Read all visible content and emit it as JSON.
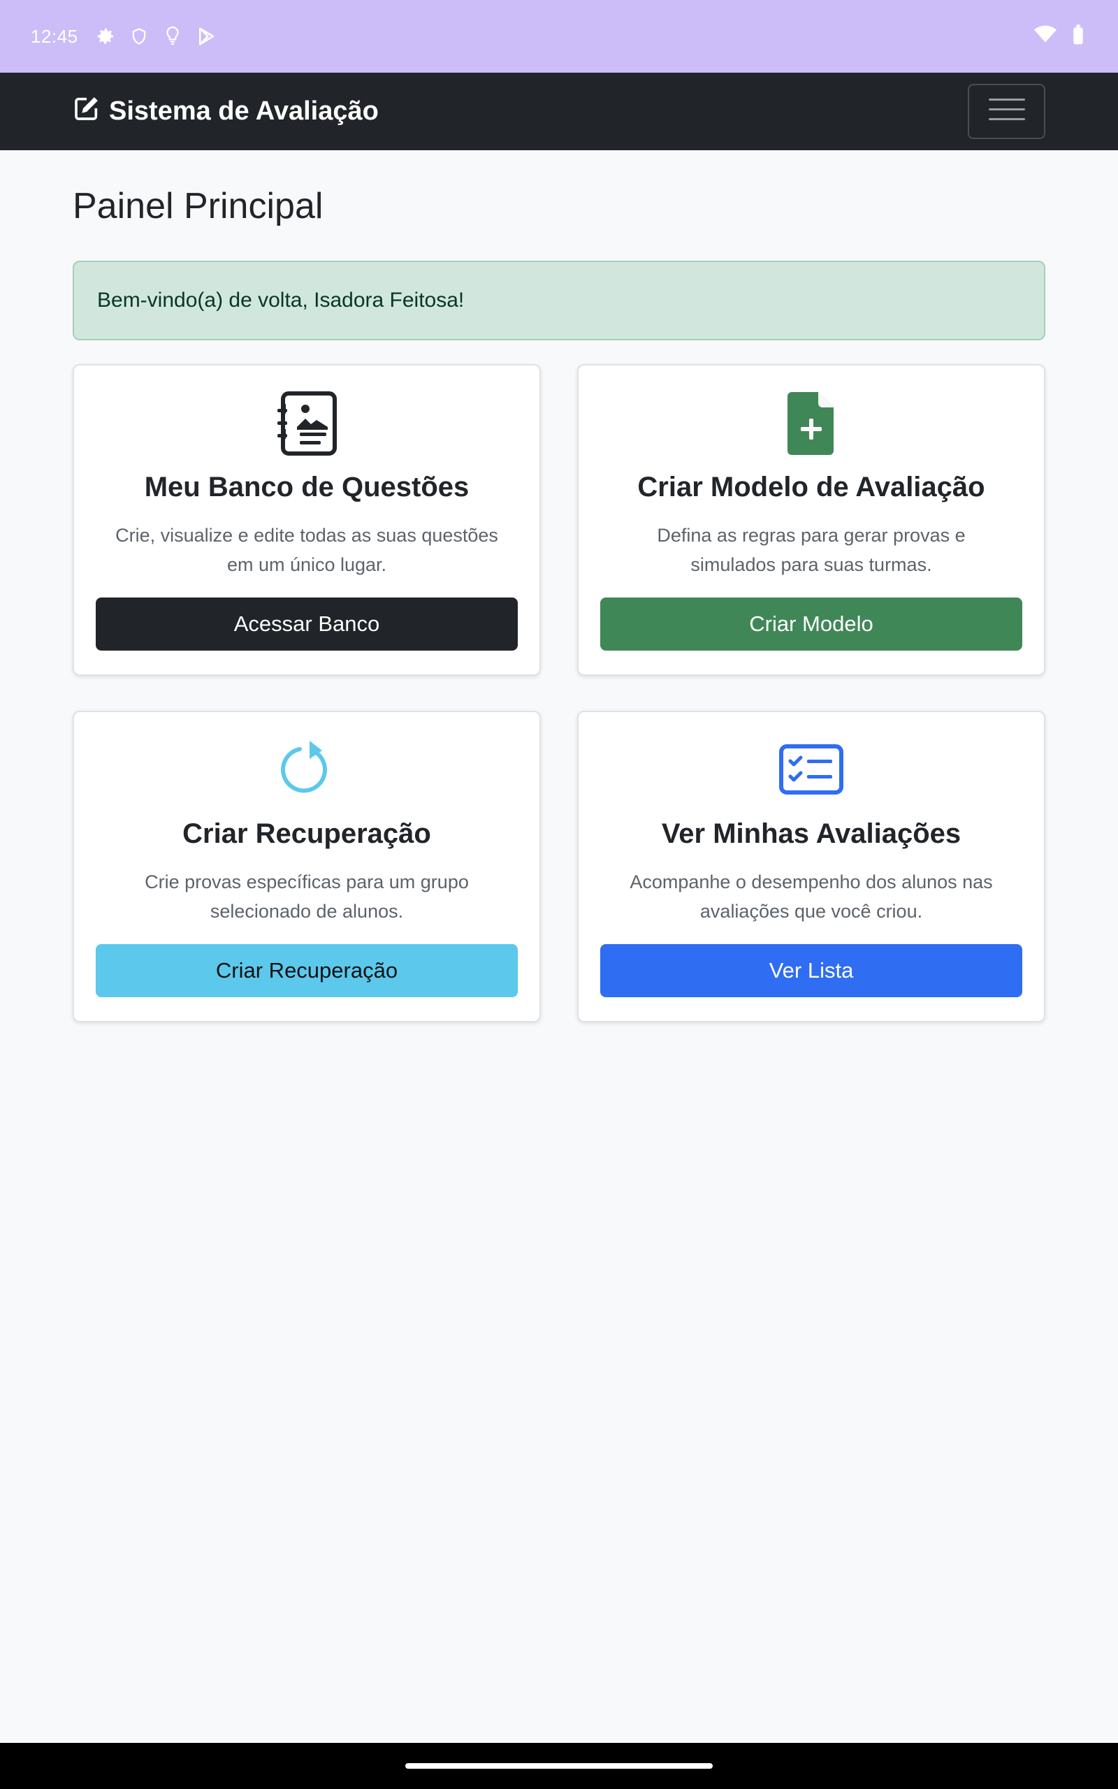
{
  "statusbar": {
    "time": "12:45",
    "left_icons": [
      "gear-icon",
      "shield-icon",
      "lightbulb-icon",
      "play-store-icon"
    ],
    "right_icons": [
      "wifi-icon",
      "battery-icon"
    ]
  },
  "navbar": {
    "brand_icon": "pencil-square-icon",
    "brand": "Sistema de Avaliação",
    "toggler_icon": "hamburger-menu-icon"
  },
  "page": {
    "title": "Painel Principal",
    "welcome": "Bem-vindo(a) de volta, Isadora Feitosa!"
  },
  "cards": [
    {
      "icon": "journal-list-icon",
      "icon_color": "#212529",
      "title": "Meu Banco de Questões",
      "text": "Crie, visualize e edite todas as suas questões em um único lugar.",
      "button": "Acessar Banco",
      "button_color": "#212529"
    },
    {
      "icon": "file-plus-icon",
      "icon_color": "#408758",
      "title": "Criar Modelo de Avaliação",
      "text": "Defina as regras para gerar provas e simulados para suas turmas.",
      "button": "Criar Modelo",
      "button_color": "#408758"
    },
    {
      "icon": "arrow-clockwise-icon",
      "icon_color": "#5cc8ec",
      "title": "Criar Recuperação",
      "text": "Crie provas específicas para um grupo selecionado de alunos.",
      "button": "Criar Recuperação",
      "button_color": "#5cc8ec"
    },
    {
      "icon": "checklist-icon",
      "icon_color": "#2f6df2",
      "title": "Ver Minhas Avaliações",
      "text": "Acompanhe o desempenho dos alunos nas avaliações que você criou.",
      "button": "Ver Lista",
      "button_color": "#2f6df2"
    }
  ]
}
